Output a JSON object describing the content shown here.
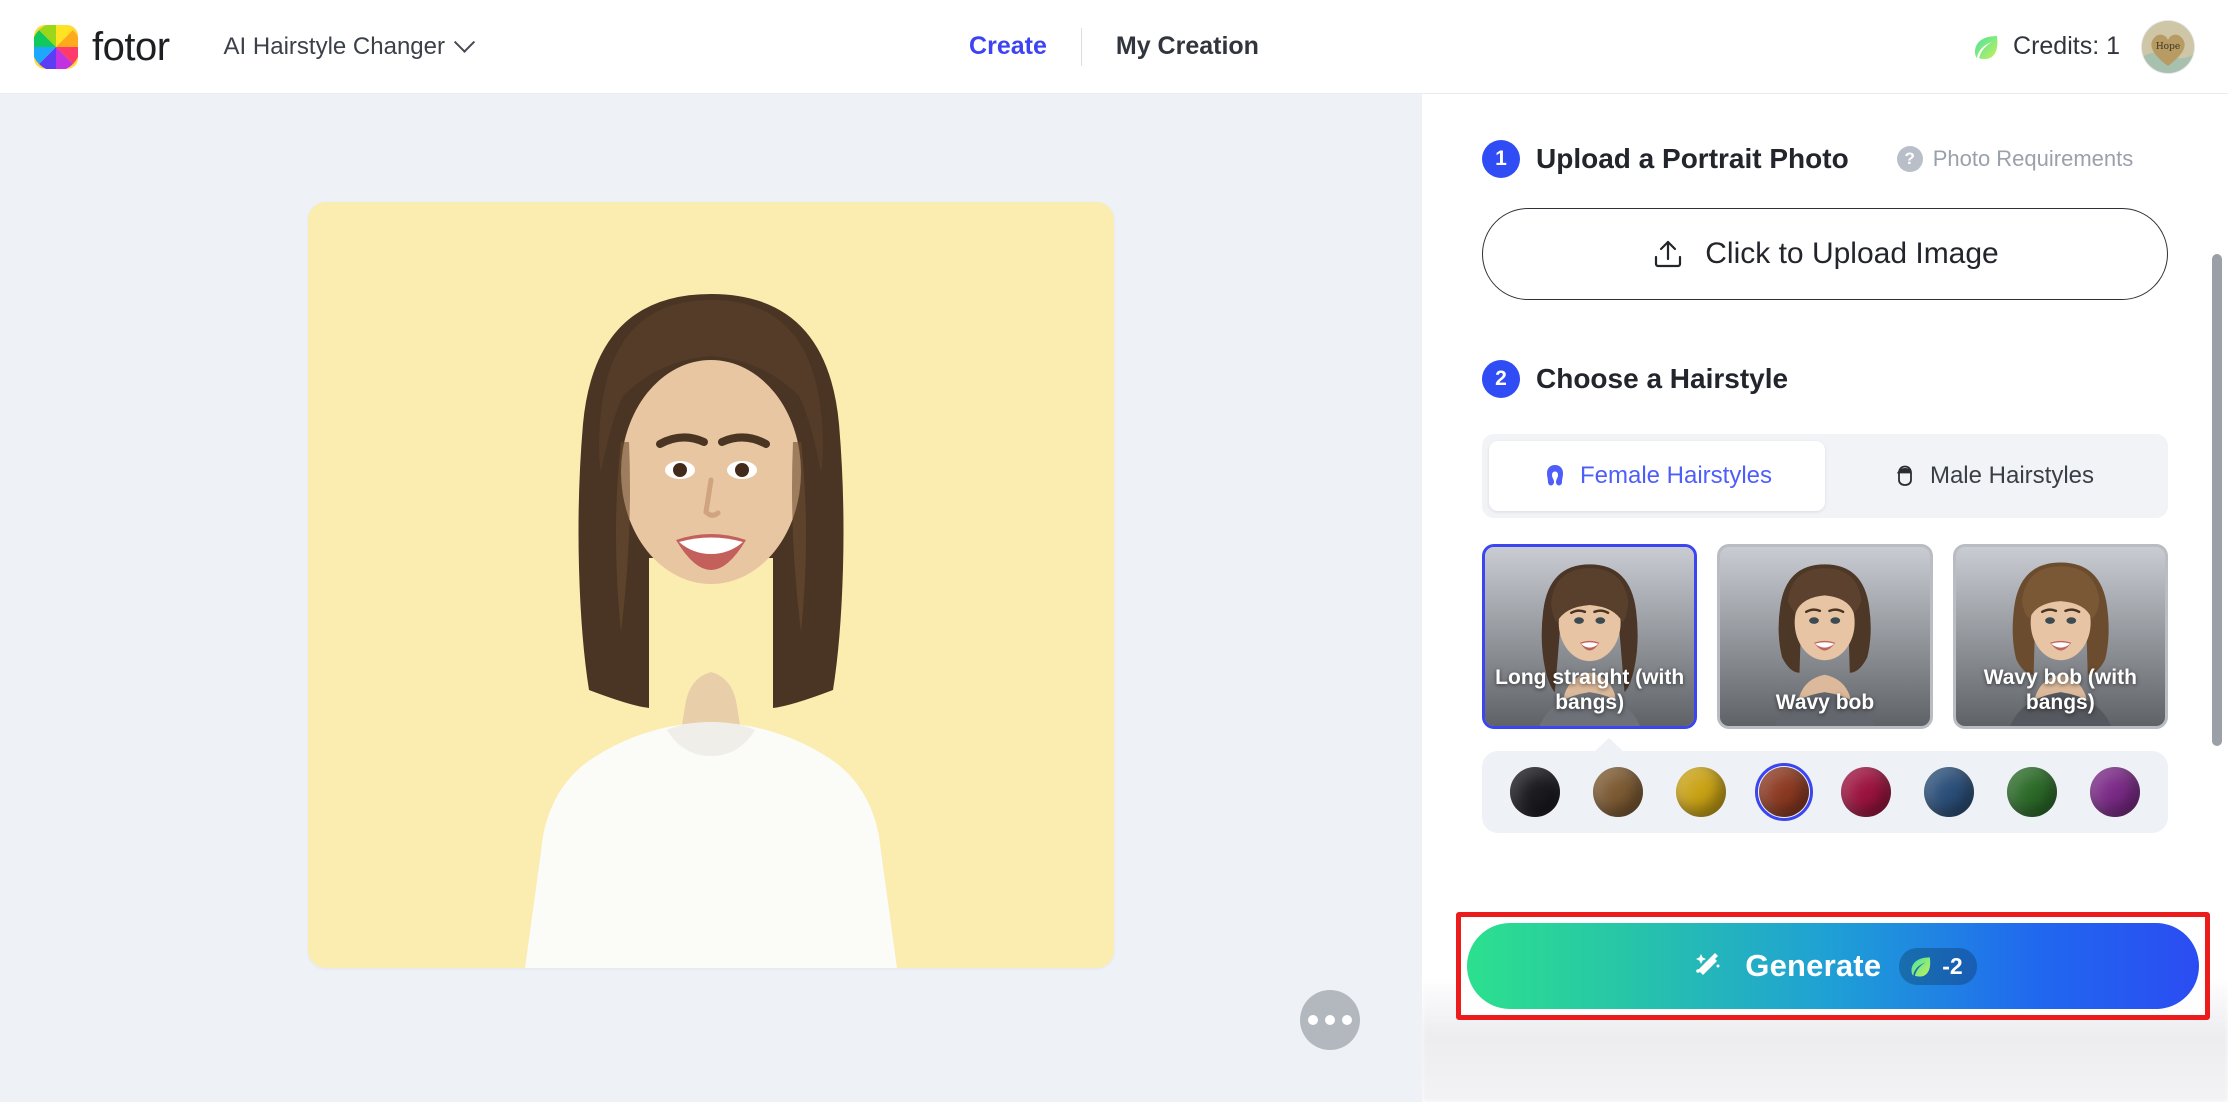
{
  "header": {
    "logo_icon": "fotor-pinwheel-logo",
    "logo_word": "fotor",
    "tool_name": "AI Hairstyle Changer",
    "tool_chevron_icon": "chevron-down-icon",
    "nav": [
      {
        "label": "Create",
        "active": true
      },
      {
        "label": "My Creation",
        "active": false
      }
    ],
    "credits_icon": "leaf-icon",
    "credits_label": "Credits: 1",
    "avatar_icon": "user-avatar-heart-hope"
  },
  "canvas": {
    "photo_alt": "Smiling woman with shoulder-length brown hair on yellow background",
    "background_color": "#eef2f7",
    "photo_background_color": "#fbecb0",
    "more_button_icon": "more-horizontal-icon"
  },
  "panel": {
    "step1": {
      "number": "1",
      "title": "Upload a Portrait Photo",
      "requirements_icon": "question-mark-icon",
      "requirements_label": "Photo Requirements",
      "upload_icon": "upload-icon",
      "upload_label": "Click to Upload Image"
    },
    "step2": {
      "number": "2",
      "title": "Choose a Hairstyle",
      "tabs": [
        {
          "label": "Female Hairstyles",
          "icon": "female-hair-icon",
          "active": true
        },
        {
          "label": "Male Hairstyles",
          "icon": "male-hair-icon",
          "active": false
        }
      ],
      "styles": [
        {
          "label": "Long straight (with bangs)",
          "selected": true
        },
        {
          "label": "Wavy bob",
          "selected": false
        },
        {
          "label": "Wavy bob (with bangs)",
          "selected": false
        }
      ],
      "colors": [
        {
          "name": "black",
          "hex": "#1b1b20",
          "selected": false
        },
        {
          "name": "brown",
          "hex": "#7c5a33",
          "selected": false
        },
        {
          "name": "blonde",
          "hex": "#c9a215",
          "selected": false
        },
        {
          "name": "auburn",
          "hex": "#8c3a22",
          "selected": true
        },
        {
          "name": "red-wine",
          "hex": "#9c1440",
          "selected": false
        },
        {
          "name": "blue",
          "hex": "#2b4f79",
          "selected": false
        },
        {
          "name": "green",
          "hex": "#2c6b29",
          "selected": false
        },
        {
          "name": "purple",
          "hex": "#7a2a86",
          "selected": false
        }
      ]
    },
    "generate": {
      "icon": "magic-wand-icon",
      "label": "Generate",
      "cost_icon": "leaf-icon",
      "cost_label": "-2",
      "highlight_color": "#ec1c1c",
      "gradient_from": "#2ce08e",
      "gradient_to": "#2b4cf2"
    }
  }
}
